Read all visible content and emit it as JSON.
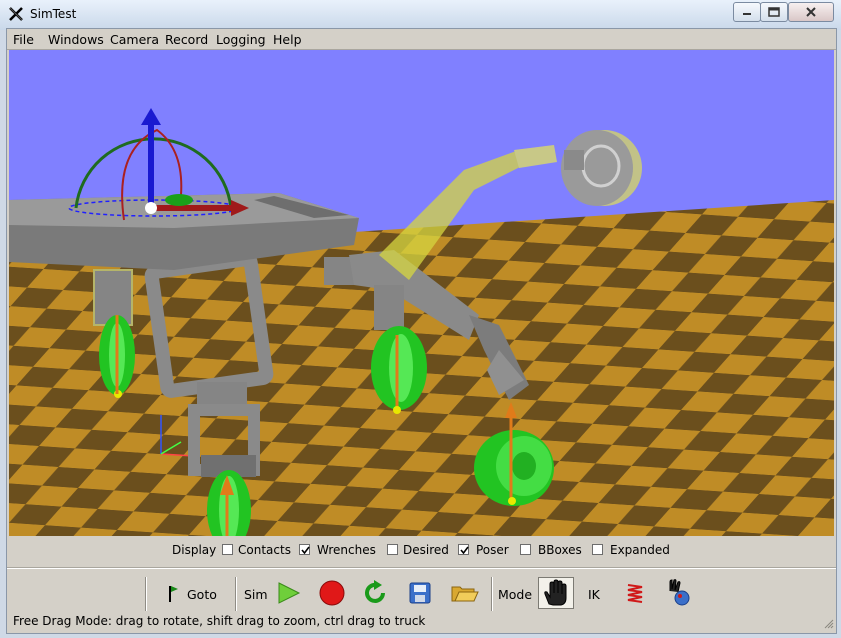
{
  "window": {
    "title": "SimTest"
  },
  "menubar": {
    "items": [
      "File",
      "Windows",
      "Camera",
      "Record",
      "Logging",
      "Help"
    ]
  },
  "display": {
    "label": "Display",
    "options": [
      {
        "label": "Contacts",
        "checked": false
      },
      {
        "label": "Wrenches",
        "checked": true
      },
      {
        "label": "Desired",
        "checked": false
      },
      {
        "label": "Poser",
        "checked": true
      },
      {
        "label": "BBoxes",
        "checked": false
      },
      {
        "label": "Expanded",
        "checked": false
      }
    ]
  },
  "toolbar": {
    "goto_label": "Goto",
    "sim_label": "Sim",
    "mode_label": "Mode",
    "ik_label": "IK",
    "icons": [
      "flag-icon",
      "play-icon",
      "record-icon",
      "reset-icon",
      "save-icon",
      "open-folder-icon",
      "hand-drag-icon",
      "spring-icon",
      "hand-ball-icon"
    ]
  },
  "status": {
    "text": "Free Drag Mode: drag to rotate, shift drag to zoom, ctrl drag to truck"
  },
  "colors": {
    "sky": "#8080ff",
    "floor_light": "#bf8c26",
    "floor_dark": "#6b4f1d",
    "robot_gray": "#808080",
    "wheel_green": "#22c422",
    "poser_yellow": "#d6d640"
  }
}
